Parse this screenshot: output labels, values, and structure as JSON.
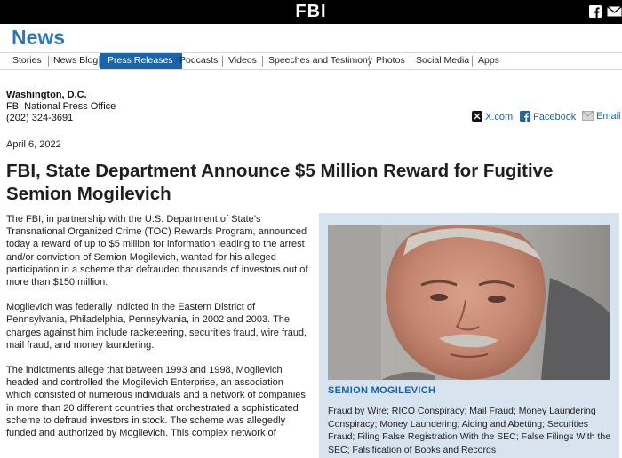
{
  "header": {
    "logo": "FBI",
    "icons": [
      "facebook-icon",
      "email-icon"
    ]
  },
  "page_title": "News",
  "nav": [
    {
      "label": "Stories",
      "active": false
    },
    {
      "label": "News Blog",
      "active": false
    },
    {
      "label": "Press Releases",
      "active": true
    },
    {
      "label": "Podcasts",
      "active": false
    },
    {
      "label": "Videos",
      "active": false
    },
    {
      "label": "Speeches and Testimony",
      "active": false
    },
    {
      "label": "Photos",
      "active": false
    },
    {
      "label": "Social Media",
      "active": false
    },
    {
      "label": "Apps",
      "active": false
    }
  ],
  "contact": {
    "location": "Washington, D.C.",
    "office": "FBI National Press Office",
    "phone": "(202) 324-3691"
  },
  "share": {
    "x_label": "X.com",
    "facebook_label": "Facebook",
    "email_label": "Email"
  },
  "article": {
    "date": "April 6, 2022",
    "headline": "FBI, State Department Announce $5 Million Reward for Fugitive Semion Mogilevich",
    "paragraphs": [
      "The FBI, in partnership with the U.S. Department of State’s Transnational Organized Crime (TOC) Rewards Program, announced today a reward of up to $5 million for information leading to the arrest and/or conviction of Semion Mogilevich, wanted for his alleged participation in a scheme that defrauded thousands of investors out of more than $150 million.",
      "Mogilevich was federally indicted in the Eastern District of Pennsylvania, Philadelphia, Pennsylvania, in 2002 and 2003. The charges against him include racketeering, securities fraud, wire fraud, mail fraud, and money laundering.",
      "The indictments allege that between 1993 and 1998, Mogilevich headed and controlled the Mogilevich Enterprise, an association which consisted of numerous individuals and a network of companies in more than 20 different countries that orchestrated a sophisticated scheme to defraud investors in stock. The scheme was allegedly funded and authorized by Mogilevich. This complex network of"
    ]
  },
  "sidebar": {
    "name": "SEMION MOGILEVICH",
    "charges": "Fraud by Wire; RICO Conspiracy; Mail Fraud; Money Laundering Conspiracy; Money Laundering; Aiding and Abetting; Securities Fraud; Filing False Registration With the SEC; False Filings With the SEC; Falsification of Books and Records"
  },
  "colors": {
    "brand_blue": "#1a65a9",
    "news_title": "#2b78b8",
    "sidebar_bg": "#d7e3ef",
    "topbar": "#000000"
  }
}
